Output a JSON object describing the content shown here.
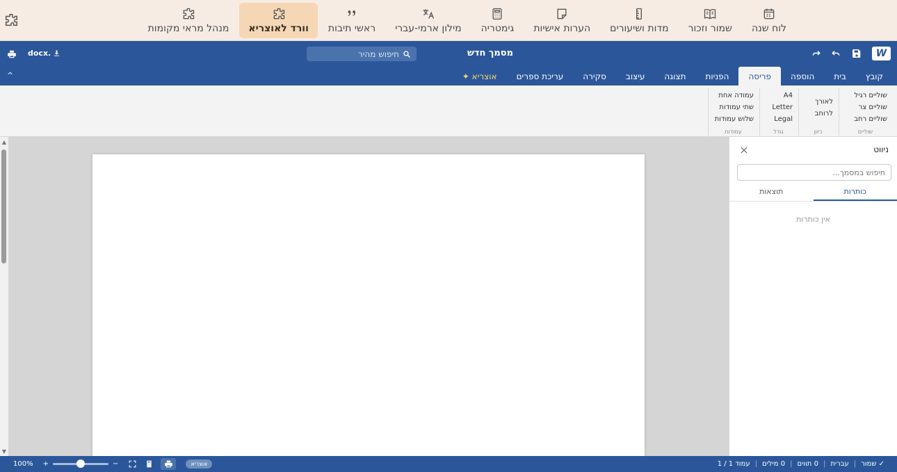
{
  "tools": [
    {
      "name": "year-calendar",
      "label": "לוח שנה",
      "icon": "calendar-icon"
    },
    {
      "name": "remember",
      "label": "שמור וזכור",
      "icon": "book-icon"
    },
    {
      "name": "measures",
      "label": "מדות ושיעורים",
      "icon": "ruler-icon"
    },
    {
      "name": "personal-notes",
      "label": "הערות אישיות",
      "icon": "note-icon"
    },
    {
      "name": "gematria",
      "label": "גימטריה",
      "icon": "calculator-icon"
    },
    {
      "name": "aramaic-dictionary",
      "label": "מילון ארמי-עברי",
      "icon": "translate-icon"
    },
    {
      "name": "acronyms",
      "label": "ראשי תיבות",
      "icon": "quote-icon"
    },
    {
      "name": "word-otzaria",
      "label": "וורד לאוצריא",
      "icon": "puzzle-icon",
      "active": true
    },
    {
      "name": "references-manager",
      "label": "מנהל מראי מקומות",
      "icon": "puzzle-icon"
    }
  ],
  "title_bar": {
    "logo": "W",
    "document_title": "מסמך חדש",
    "quick_search_placeholder": "חיפוש מהיר",
    "download_label": "docx."
  },
  "ribbon_tabs": [
    {
      "label": "קובץ"
    },
    {
      "label": "בית"
    },
    {
      "label": "הוספה"
    },
    {
      "label": "פריסה",
      "active": true
    },
    {
      "label": "הפניות"
    },
    {
      "label": "תצוגה"
    },
    {
      "label": "עיצוב"
    },
    {
      "label": "סקירה"
    },
    {
      "label": "עריכת ספרים"
    },
    {
      "label": "✦ אוצריא"
    }
  ],
  "ribbon_groups": {
    "margins": {
      "label": "שוליים",
      "items": [
        "שוליים רגיל",
        "שוליים צר",
        "שוליים רחב"
      ]
    },
    "orientation": {
      "label": "כיוון",
      "items": [
        "לאורך",
        "לרוחב"
      ]
    },
    "size": {
      "label": "גודל",
      "items": [
        "A4",
        "Letter",
        "Legal"
      ]
    },
    "columns": {
      "label": "עמודות",
      "items": [
        "עמודה אחת",
        "שתי עמודות",
        "שלוש עמודות"
      ]
    }
  },
  "nav_pane": {
    "title": "ניווט",
    "search_placeholder": "חיפוש במסמך...",
    "tabs": [
      "כותרות",
      "תוצאות"
    ],
    "active_tab": "כותרות",
    "empty_message": "אין כותרות"
  },
  "status_bar": {
    "page": "עמוד 1 / 1",
    "words": "0 מילים",
    "chars": "0 תווים",
    "language": "עברית",
    "saved": "✓ שמור",
    "ai_badge": "אוצריא",
    "zoom": "100%",
    "zoom_level": 0.5
  },
  "colors": {
    "accent": "#2b579a",
    "tools_bg": "#f6ece4",
    "active_tool_bg": "#f6d7b5"
  }
}
